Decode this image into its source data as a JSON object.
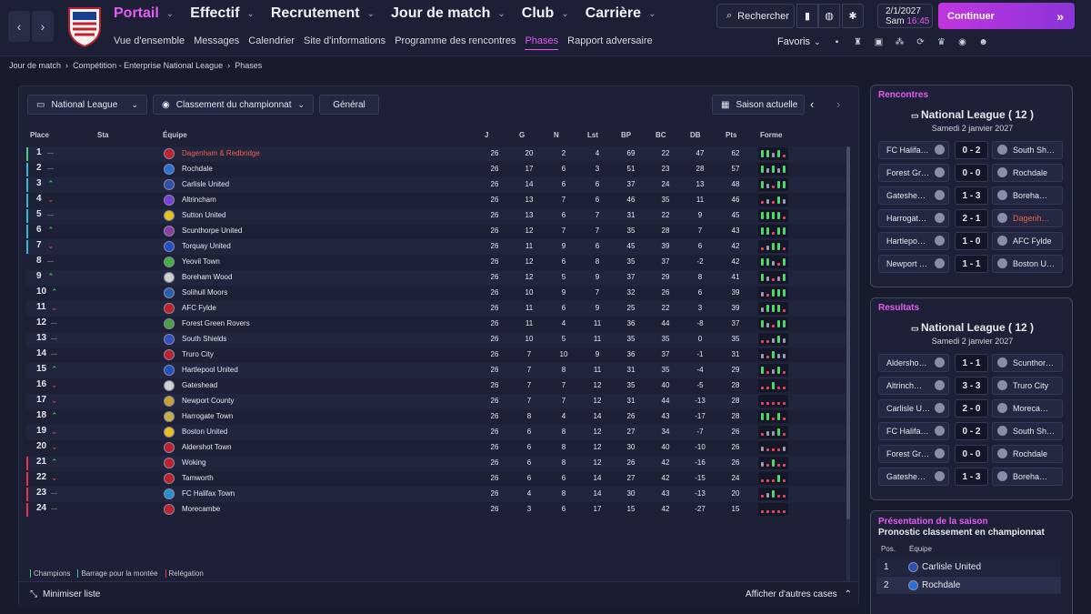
{
  "topbar": {
    "nav": [
      {
        "label": "Portail",
        "active": true
      },
      {
        "label": "Effectif",
        "active": false
      },
      {
        "label": "Recrutement",
        "active": false
      },
      {
        "label": "Jour de match",
        "active": false
      },
      {
        "label": "Club",
        "active": false
      },
      {
        "label": "Carrière",
        "active": false
      }
    ],
    "subnav": [
      "Vue d'ensemble",
      "Messages",
      "Calendrier",
      "Site d'informations",
      "Programme des rencontres",
      "Phases",
      "Rapport adversaire"
    ],
    "subnav_active": 5,
    "search_label": "Rechercher",
    "date": "2/1/2027",
    "day": "Sam",
    "time": "16:45",
    "continue_label": "Continuer",
    "favorites_label": "Favoris"
  },
  "breadcrumb": [
    "Jour de match",
    "Compétition - Enterprise National League",
    "Phases"
  ],
  "controls": {
    "league": "National League",
    "view": "Classement du championnat",
    "scope": "Général",
    "season": "Saison actuelle"
  },
  "table": {
    "headers": {
      "place": "Place",
      "sta": "Sta",
      "team": "Équipe",
      "j": "J",
      "g": "G",
      "n": "N",
      "l": "Lst",
      "bp": "BP",
      "bc": "BC",
      "db": "DB",
      "pts": "Pts",
      "form": "Forme"
    },
    "rows": [
      {
        "place": "1",
        "trend": "—",
        "team": "Dagenham & Redbridge",
        "j": "26",
        "g": "20",
        "n": "2",
        "l": "4",
        "bp": "69",
        "bc": "22",
        "db": "47",
        "pts": "62",
        "highlight": true,
        "zone": "champ",
        "form": "WWDWL"
      },
      {
        "place": "2",
        "trend": "—",
        "team": "Rochdale",
        "j": "26",
        "g": "17",
        "n": "6",
        "l": "3",
        "bp": "51",
        "bc": "23",
        "db": "28",
        "pts": "57",
        "zone": "promo",
        "form": "WDWDW"
      },
      {
        "place": "3",
        "trend": "^",
        "team": "Carlisle United",
        "j": "26",
        "g": "14",
        "n": "6",
        "l": "6",
        "bp": "37",
        "bc": "24",
        "db": "13",
        "pts": "48",
        "zone": "promo",
        "form": "WDLWW"
      },
      {
        "place": "4",
        "trend": "v",
        "team": "Altrincham",
        "j": "26",
        "g": "13",
        "n": "7",
        "l": "6",
        "bp": "46",
        "bc": "35",
        "db": "11",
        "pts": "46",
        "zone": "promo",
        "form": "LDLWD"
      },
      {
        "place": "5",
        "trend": "—",
        "team": "Sutton United",
        "j": "26",
        "g": "13",
        "n": "6",
        "l": "7",
        "bp": "31",
        "bc": "22",
        "db": "9",
        "pts": "45",
        "zone": "promo",
        "form": "WWWWL"
      },
      {
        "place": "6",
        "trend": "^",
        "team": "Scunthorpe United",
        "j": "26",
        "g": "12",
        "n": "7",
        "l": "7",
        "bp": "35",
        "bc": "28",
        "db": "7",
        "pts": "43",
        "zone": "promo",
        "form": "WWLWW"
      },
      {
        "place": "7",
        "trend": "v",
        "team": "Torquay United",
        "j": "26",
        "g": "11",
        "n": "9",
        "l": "6",
        "bp": "45",
        "bc": "39",
        "db": "6",
        "pts": "42",
        "zone": "promo",
        "form": "LDWWL"
      },
      {
        "place": "8",
        "trend": "—",
        "team": "Yeovil Town",
        "j": "26",
        "g": "12",
        "n": "6",
        "l": "8",
        "bp": "35",
        "bc": "37",
        "db": "-2",
        "pts": "42",
        "form": "WWDLW"
      },
      {
        "place": "9",
        "trend": "^",
        "team": "Boreham Wood",
        "j": "26",
        "g": "12",
        "n": "5",
        "l": "9",
        "bp": "37",
        "bc": "29",
        "db": "8",
        "pts": "41",
        "form": "WDLDW"
      },
      {
        "place": "10",
        "trend": "^",
        "team": "Solihull Moors",
        "j": "26",
        "g": "10",
        "n": "9",
        "l": "7",
        "bp": "32",
        "bc": "26",
        "db": "6",
        "pts": "39",
        "form": "DLWWW"
      },
      {
        "place": "11",
        "trend": "v",
        "team": "AFC Fylde",
        "j": "26",
        "g": "11",
        "n": "6",
        "l": "9",
        "bp": "25",
        "bc": "22",
        "db": "3",
        "pts": "39",
        "form": "DWWWL"
      },
      {
        "place": "12",
        "trend": "—",
        "team": "Forest Green Rovers",
        "j": "26",
        "g": "11",
        "n": "4",
        "l": "11",
        "bp": "36",
        "bc": "44",
        "db": "-8",
        "pts": "37",
        "form": "WDLWW"
      },
      {
        "place": "13",
        "trend": "—",
        "team": "South Shields",
        "j": "26",
        "g": "10",
        "n": "5",
        "l": "11",
        "bp": "35",
        "bc": "35",
        "db": "0",
        "pts": "35",
        "form": "LLDWD"
      },
      {
        "place": "14",
        "trend": "—",
        "team": "Truro City",
        "j": "26",
        "g": "7",
        "n": "10",
        "l": "9",
        "bp": "36",
        "bc": "37",
        "db": "-1",
        "pts": "31",
        "form": "DLWDD"
      },
      {
        "place": "15",
        "trend": "^",
        "team": "Hartlepool United",
        "j": "26",
        "g": "7",
        "n": "8",
        "l": "11",
        "bp": "31",
        "bc": "35",
        "db": "-4",
        "pts": "29",
        "form": "WLDWL"
      },
      {
        "place": "16",
        "trend": "v",
        "team": "Gateshead",
        "j": "26",
        "g": "7",
        "n": "7",
        "l": "12",
        "bp": "35",
        "bc": "40",
        "db": "-5",
        "pts": "28",
        "form": "LLWLL"
      },
      {
        "place": "17",
        "trend": "v",
        "team": "Newport County",
        "j": "26",
        "g": "7",
        "n": "7",
        "l": "12",
        "bp": "31",
        "bc": "44",
        "db": "-13",
        "pts": "28",
        "form": "LLLLL"
      },
      {
        "place": "18",
        "trend": "^",
        "team": "Harrogate Town",
        "j": "26",
        "g": "8",
        "n": "4",
        "l": "14",
        "bp": "26",
        "bc": "43",
        "db": "-17",
        "pts": "28",
        "form": "WWLWL"
      },
      {
        "place": "19",
        "trend": "v",
        "team": "Boston United",
        "j": "26",
        "g": "6",
        "n": "8",
        "l": "12",
        "bp": "27",
        "bc": "34",
        "db": "-7",
        "pts": "26",
        "form": "LDDWL"
      },
      {
        "place": "20",
        "trend": "v",
        "team": "Aldershot Town",
        "j": "26",
        "g": "6",
        "n": "8",
        "l": "12",
        "bp": "30",
        "bc": "40",
        "db": "-10",
        "pts": "26",
        "form": "DLLLD"
      },
      {
        "place": "21",
        "trend": "^",
        "team": "Woking",
        "j": "26",
        "g": "6",
        "n": "8",
        "l": "12",
        "bp": "26",
        "bc": "42",
        "db": "-16",
        "pts": "26",
        "zone": "releg",
        "form": "DLWLL"
      },
      {
        "place": "22",
        "trend": "v",
        "team": "Tamworth",
        "j": "26",
        "g": "6",
        "n": "6",
        "l": "14",
        "bp": "27",
        "bc": "42",
        "db": "-15",
        "pts": "24",
        "zone": "releg",
        "form": "LLLWL"
      },
      {
        "place": "23",
        "trend": "—",
        "team": "FC Halifax Town",
        "j": "26",
        "g": "4",
        "n": "8",
        "l": "14",
        "bp": "30",
        "bc": "43",
        "db": "-13",
        "pts": "20",
        "zone": "releg",
        "form": "LDWLL"
      },
      {
        "place": "24",
        "trend": "—",
        "team": "Morecambe",
        "j": "26",
        "g": "3",
        "n": "6",
        "l": "17",
        "bp": "15",
        "bc": "42",
        "db": "-27",
        "pts": "15",
        "zone": "releg",
        "form": "LLLLL"
      }
    ]
  },
  "legend": {
    "champ": "Champions",
    "promo": "Barrage pour la montée",
    "releg": "Relégation"
  },
  "footer": {
    "minimize": "Minimiser liste",
    "more": "Afficher d'autres cases"
  },
  "rencontres": {
    "title": "Rencontres",
    "league": "National League  ( 12 )",
    "date": "Samedi 2 janvier 2027",
    "matches": [
      {
        "home": "FC Halifa…",
        "score": "0 - 2",
        "away": "South Sh…"
      },
      {
        "home": "Forest Gr…",
        "score": "0 - 0",
        "away": "Rochdale"
      },
      {
        "home": "Gateshe…",
        "score": "1 - 3",
        "away": "Boreha…"
      },
      {
        "home": "Harrogat…",
        "score": "2 - 1",
        "away": "Dagenh…",
        "away_highlight": true
      },
      {
        "home": "Hartlepo…",
        "score": "1 - 0",
        "away": "AFC Fylde"
      },
      {
        "home": "Newport …",
        "score": "1 - 1",
        "away": "Boston U…"
      }
    ]
  },
  "resultats": {
    "title": "Resultats",
    "league": "National League  ( 12 )",
    "date": "Samedi 2 janvier 2027",
    "matches": [
      {
        "home": "Aldersho…",
        "score": "1 - 1",
        "away": "Scunthor…"
      },
      {
        "home": "Altrinch…",
        "score": "3 - 3",
        "away": "Truro City"
      },
      {
        "home": "Carlisle U…",
        "score": "2 - 0",
        "away": "Moreca…"
      },
      {
        "home": "FC Halifa…",
        "score": "0 - 2",
        "away": "South Sh…"
      },
      {
        "home": "Forest Gr…",
        "score": "0 - 0",
        "away": "Rochdale"
      },
      {
        "home": "Gateshe…",
        "score": "1 - 3",
        "away": "Boreha…"
      }
    ]
  },
  "preview": {
    "title": "Présentation de la saison",
    "subtitle": "Pronostic classement en championnat",
    "head_pos": "Pos.",
    "head_team": "Équipe",
    "rows": [
      {
        "pos": "1",
        "team": "Carlisle United"
      },
      {
        "pos": "2",
        "team": "Rochdale"
      }
    ]
  },
  "colors": {
    "accent": "#e45cf2",
    "win": "#4cd964",
    "draw": "#9a9cb0",
    "loss": "#f0455a",
    "champ": "#3fd27a",
    "promo": "#2fb8d8",
    "releg": "#e8344a"
  }
}
